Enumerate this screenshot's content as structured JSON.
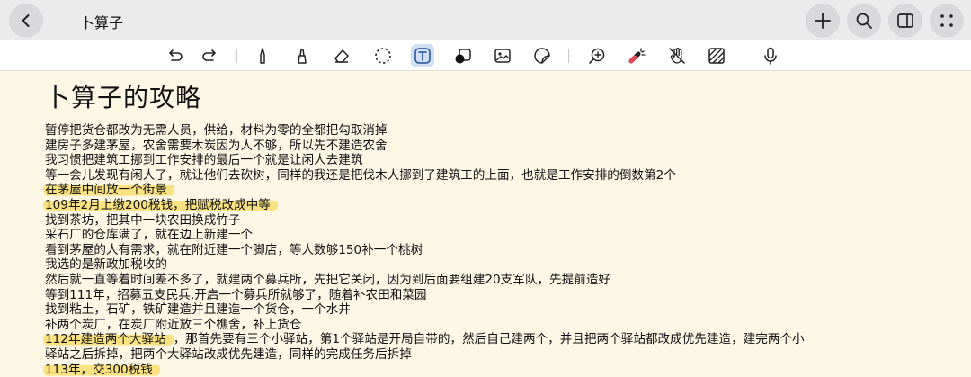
{
  "header": {
    "title": "卜算子"
  },
  "toolbar": {
    "tools": [
      "undo-icon",
      "redo-icon",
      "pen-icon",
      "highlighter-icon",
      "eraser-icon",
      "lasso-icon",
      "text-icon",
      "shape-icon",
      "image-icon",
      "sticker-icon",
      "zoom-icon",
      "laser-pointer-icon",
      "hand-icon",
      "pattern-icon",
      "microphone-icon"
    ],
    "active_tool": "text-icon"
  },
  "note": {
    "heading": "卜算子的攻略",
    "highlight_color": "#fade6e",
    "lines": [
      "暂停把货仓都改为无需人员，供给，材料为零的全都把勾取消掉",
      "建房子多建茅屋，农舍需要木炭因为人不够，所以先不建造农舍",
      "我习惯把建筑工挪到工作安排的最后一个就是让闲人去建筑",
      "等一会儿发现有闲人了，就让他们去砍树，同样的我还是把伐木人挪到了建筑工的上面，也就是工作安排的倒数第2个",
      "在茅屋中间放一个街景",
      "109年2月上缴200税钱，把赋税改成中等",
      "找到茶坊，把其中一块农田换成竹子",
      " 采石厂的仓库满了，就在边上新建一个",
      "看到茅屋的人有需求，就在附近建一个脚店，等人数够150补一个桃树",
      "我选的是新政加税收的",
      "然后就一直等着时间差不多了，就建两个募兵所，先把它关闭，因为到后面要组建20支军队，先提前造好",
      "等到111年，招募五支民兵,开启一个募兵所就够了，随着补农田和菜园",
      "找到粘土，石矿，铁矿建造并且建造一个货仓，一个水井",
      "补两个炭厂，在炭厂附近放三个樵舍，补上货仓",
      "112年建造两个大驿站，那首先要有三个小驿站，第1个驿站是开局自带的，然后自己建两个，并且把两个驿站都改成优先建造，建完两个小",
      "驿站之后拆掉，把两个大驿站改成优先建造，同样的完成任务后拆掉",
      "113年，交300税钱"
    ],
    "highlights": {
      "line4": "在茅屋中间放一个街景",
      "line5": "109年2月上缴200税钱，把赋税改成中等",
      "line14_head": "112年建造两个大驿站",
      "line14_tail": "，那首先要有三个小驿站，第1个驿站是开局自带的，然后自己建两个，并且把两个驿站都改成优先建造，建完两个小",
      "line16": "113年，交300税钱"
    }
  }
}
